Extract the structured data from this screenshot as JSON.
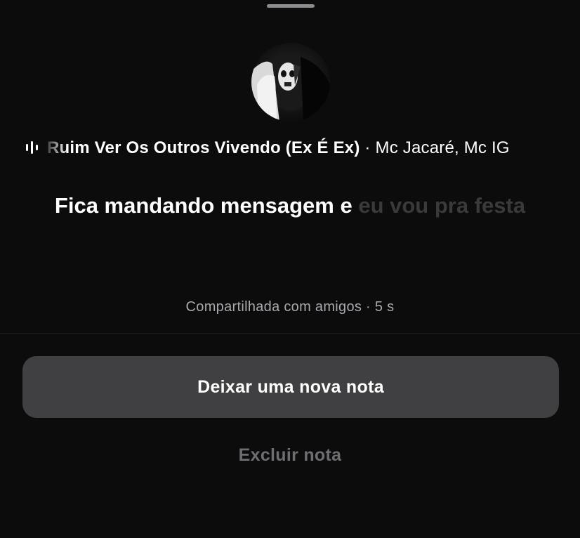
{
  "note_sheet": {
    "music": {
      "icon": "audio-waveform-icon",
      "song_title": "Ruim Ver Os Outros Vivendo (Ex É Ex)",
      "separator": " · ",
      "artist": "Mc Jacaré, Mc IG"
    },
    "lyrics": {
      "highlighted": "Fica mandando mensagem e",
      "upcoming": "eu vou pra festa"
    },
    "meta": "Compartilhada com amigos · 5 s",
    "primary_button_label": "Deixar uma nova nota",
    "secondary_button_label": "Excluir nota"
  }
}
